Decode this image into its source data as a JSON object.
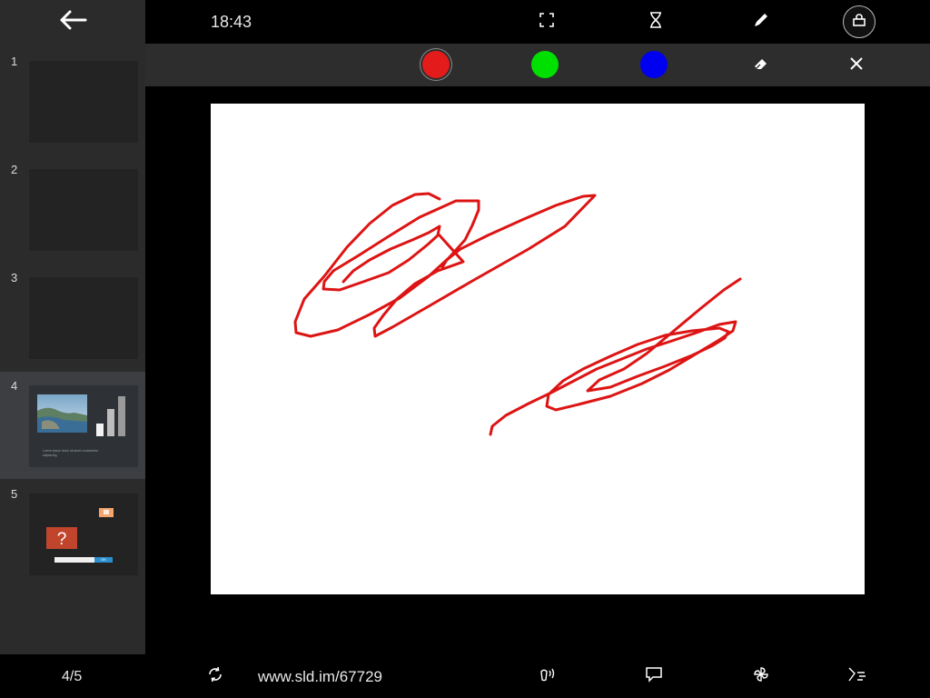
{
  "window": {
    "clock": "18:43"
  },
  "sidebar": {
    "slides": [
      {
        "number": "1",
        "active": false
      },
      {
        "number": "2",
        "active": false
      },
      {
        "number": "3",
        "active": false
      },
      {
        "number": "4",
        "active": true,
        "caption": "Lorem ipsum dolor sit amet consectetur adipiscing"
      },
      {
        "number": "5",
        "active": false,
        "button_label": "OK"
      }
    ]
  },
  "colors": {
    "red": "#e31b1b",
    "green": "#00e000",
    "blue": "#0000f0",
    "stroke": "#dd1414",
    "selected": "red"
  },
  "bottombar": {
    "page_indicator": "4/5",
    "url": "www.sld.im/67729"
  },
  "icons": {
    "back": "arrow-left-icon",
    "fullscreen": "fullscreen-icon",
    "timer": "hourglass-icon",
    "pen": "pencil-icon",
    "lock": "lock-icon",
    "eraser": "eraser-icon",
    "close": "close-icon",
    "sync": "sync-icon",
    "broadcast": "broadcast-icon",
    "comment": "comment-icon",
    "settings": "pinwheel-icon",
    "laser": "laser-icon"
  }
}
